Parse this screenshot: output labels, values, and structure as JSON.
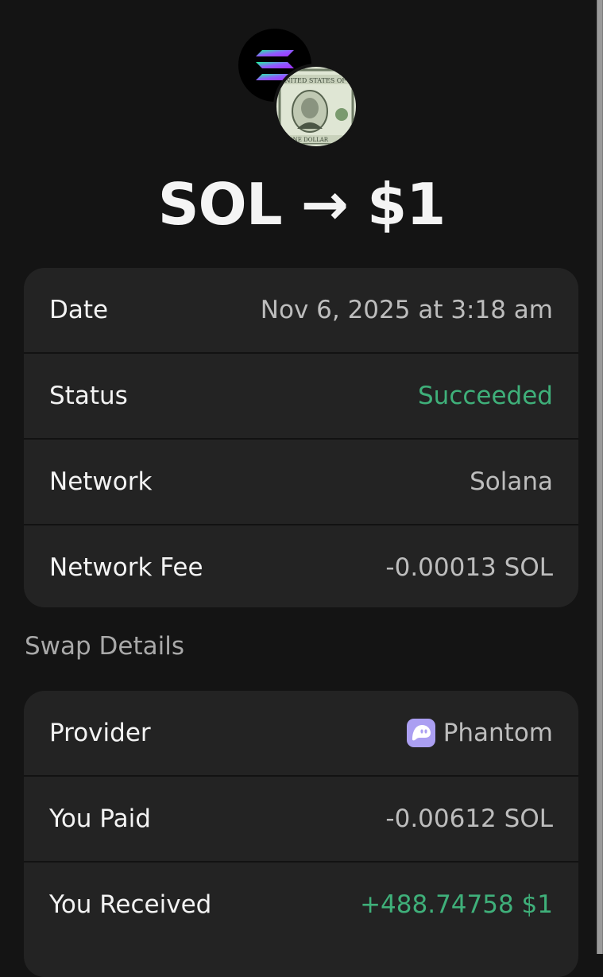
{
  "header": {
    "title": "SOL → $1",
    "from_token_icon": "solana-logo-icon",
    "to_token_icon": "dollar-bill-token-icon"
  },
  "transaction": {
    "rows": [
      {
        "label": "Date",
        "value": "Nov 6, 2025 at 3:18 am"
      },
      {
        "label": "Status",
        "value": "Succeeded"
      },
      {
        "label": "Network",
        "value": "Solana"
      },
      {
        "label": "Network Fee",
        "value": "-0.00013 SOL"
      }
    ]
  },
  "swap_details": {
    "heading": "Swap Details",
    "rows": [
      {
        "label": "Provider",
        "value": "Phantom",
        "icon": "phantom-ghost-icon"
      },
      {
        "label": "You Paid",
        "value": "-0.00612 SOL"
      },
      {
        "label": "You Received",
        "value": "+488.74758 $1"
      }
    ]
  },
  "colors": {
    "background": "#141414",
    "card": "#232323",
    "success_green": "#3fb07a",
    "phantom_purple": "#ab9ff2"
  }
}
